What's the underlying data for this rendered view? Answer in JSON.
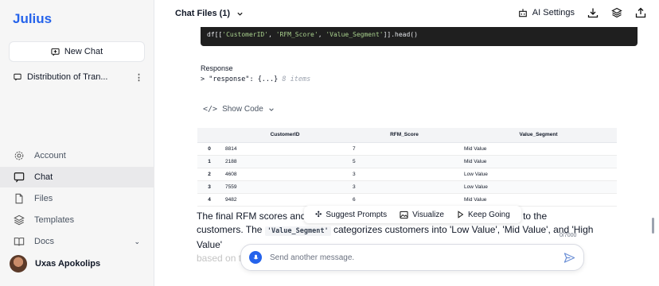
{
  "app": {
    "name": "Julius"
  },
  "sidebar": {
    "new_chat_label": "New Chat",
    "chat_history": [
      {
        "label": "Distribution of Tran..."
      }
    ],
    "nav": [
      {
        "label": "Account",
        "icon": "gear-icon"
      },
      {
        "label": "Chat",
        "icon": "chat-bubble-icon",
        "active": true
      },
      {
        "label": "Files",
        "icon": "file-icon"
      },
      {
        "label": "Templates",
        "icon": "layers-icon"
      },
      {
        "label": "Docs",
        "icon": "book-icon"
      }
    ],
    "user": {
      "name": "Uxas Apokolips"
    }
  },
  "header": {
    "title": "Chat Files (1)",
    "ai_settings_label": "AI Settings"
  },
  "code": {
    "prefix": "df[[",
    "col1": "'CustomerID'",
    "col2": "'RFM_Score'",
    "col3": "'Value_Segment'",
    "suffix": "]].head()"
  },
  "response": {
    "label": "Response",
    "key": "\"response\"",
    "collapsed": "{...}",
    "items_note": "8 items"
  },
  "show_code_label": "Show Code",
  "table": {
    "headers": [
      "",
      "CustomerID",
      "RFM_Score",
      "Value_Segment"
    ],
    "rows": [
      [
        "0",
        "8814",
        "7",
        "Mid Value"
      ],
      [
        "1",
        "2188",
        "5",
        "Mid Value"
      ],
      [
        "2",
        "4608",
        "3",
        "Low Value"
      ],
      [
        "3",
        "7559",
        "3",
        "Low Value"
      ],
      [
        "4",
        "9482",
        "6",
        "Mid Value"
      ]
    ]
  },
  "summary": {
    "p1_start": "The final RFM scores and c",
    "p1_end": "assigned to the",
    "p2_start": "customers. The",
    "code_term": "'Value_Segment'",
    "p2_end": "categorizes customers into 'Low Value', 'Mid Value', and 'High Value'",
    "p3": "based on their RFM scores."
  },
  "actions": {
    "suggest": "Suggest Prompts",
    "visualize": "Visualize",
    "keep_going": "Keep Going"
  },
  "composer": {
    "counter": "0/7000",
    "placeholder": "Send another message."
  },
  "colors": {
    "brand": "#2563eb",
    "code_bg": "#1f1f1f"
  }
}
